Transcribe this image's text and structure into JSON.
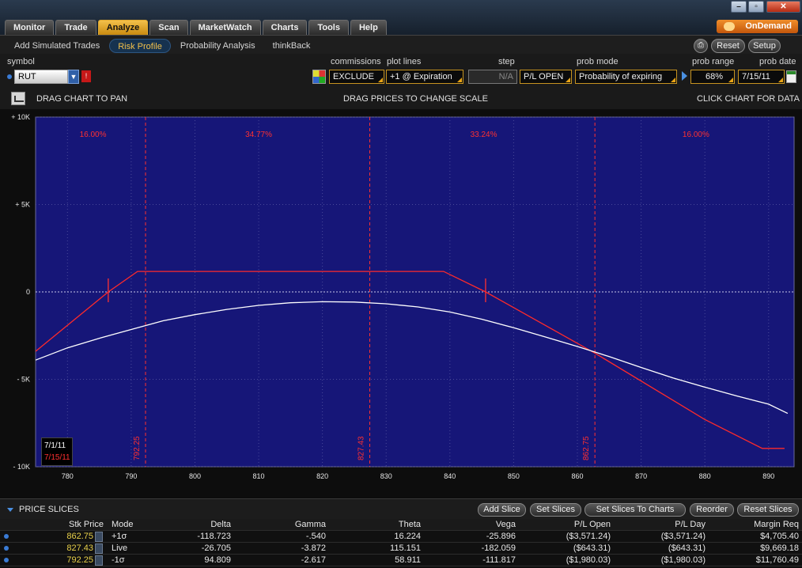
{
  "tabs": [
    "Monitor",
    "Trade",
    "Analyze",
    "Scan",
    "MarketWatch",
    "Charts",
    "Tools",
    "Help"
  ],
  "active_tab": "Analyze",
  "ondemand_label": "OnDemand",
  "window_controls": [
    "minimize-icon",
    "restore-icon",
    "close-icon"
  ],
  "subtabs": [
    "Add Simulated Trades",
    "Risk Profile",
    "Probability Analysis",
    "thinkBack"
  ],
  "active_subtab": "Risk Profile",
  "header_buttons": {
    "reset": "Reset",
    "setup": "Setup",
    "print_icon": "print-icon"
  },
  "controls": {
    "symbol_label": "symbol",
    "symbol_value": "RUT",
    "commissions_label": "commissions",
    "commissions_value": "EXCLUDE",
    "plot_lines_label": "plot lines",
    "plot_lines_value": "+1 @ Expiration",
    "step_label": "step",
    "step_value": "N/A",
    "step_mode_value": "P/L OPEN",
    "prob_mode_label": "prob mode",
    "prob_mode_value": "Probability of expiring",
    "prob_range_label": "prob range",
    "prob_range_value": "68%",
    "prob_date_label": "prob date",
    "prob_date_value": "7/15/11"
  },
  "chart_bar": {
    "left": "DRAG CHART TO PAN",
    "center": "DRAG PRICES TO CHANGE SCALE",
    "right": "CLICK CHART FOR DATA"
  },
  "chart_data": {
    "type": "line",
    "x_range": [
      775,
      894
    ],
    "y_range": [
      -10000,
      10000
    ],
    "x_ticks": [
      780,
      790,
      800,
      810,
      820,
      830,
      840,
      850,
      860,
      870,
      880,
      890
    ],
    "y_ticks": [
      {
        "value": 10000,
        "label": "+ 10K"
      },
      {
        "value": 5000,
        "label": "+ 5K"
      },
      {
        "value": 0,
        "label": "0"
      },
      {
        "value": -5000,
        "label": "- 5K"
      },
      {
        "value": -10000,
        "label": "- 10K"
      }
    ],
    "grid": true,
    "background_color": "#161678",
    "sigma_lines": [
      {
        "x": 792.25,
        "label": "792.25"
      },
      {
        "x": 827.43,
        "label": "827.43"
      },
      {
        "x": 862.75,
        "label": "862.75"
      }
    ],
    "region_probabilities": [
      {
        "x": 784,
        "label": "16.00%"
      },
      {
        "x": 810,
        "label": "34.77%"
      },
      {
        "x": 845.3,
        "label": "33.24%"
      },
      {
        "x": 878.6,
        "label": "16.00%"
      }
    ],
    "breakeven_marks": [
      786.4,
      845.6
    ],
    "series": [
      {
        "color": "#ff2a2a",
        "points": [
          [
            775,
            -3400
          ],
          [
            786.4,
            0
          ],
          [
            791,
            1170
          ],
          [
            839,
            1170
          ],
          [
            845.6,
            0
          ],
          [
            862.75,
            -3500
          ],
          [
            880,
            -7300
          ],
          [
            889,
            -8950
          ],
          [
            892.5,
            -8950
          ]
        ]
      },
      {
        "color": "#ffffff",
        "points": [
          [
            775,
            -3900
          ],
          [
            780,
            -3200
          ],
          [
            785,
            -2650
          ],
          [
            790,
            -2150
          ],
          [
            795,
            -1650
          ],
          [
            800,
            -1300
          ],
          [
            805,
            -1000
          ],
          [
            810,
            -770
          ],
          [
            815,
            -620
          ],
          [
            820,
            -560
          ],
          [
            825,
            -580
          ],
          [
            830,
            -680
          ],
          [
            835,
            -860
          ],
          [
            840,
            -1150
          ],
          [
            845,
            -1560
          ],
          [
            850,
            -2050
          ],
          [
            855,
            -2580
          ],
          [
            860,
            -3120
          ],
          [
            865,
            -3700
          ],
          [
            870,
            -4320
          ],
          [
            875,
            -4920
          ],
          [
            880,
            -5450
          ],
          [
            885,
            -5950
          ],
          [
            890,
            -6420
          ],
          [
            893,
            -6950
          ]
        ]
      }
    ],
    "date_legend": [
      {
        "label": "7/1/11",
        "color": "#ffffff"
      },
      {
        "label": "7/15/11",
        "color": "#ff3030"
      }
    ]
  },
  "price_slices": {
    "title": "PRICE SLICES",
    "buttons": [
      "Add Slice",
      "Set Slices",
      "Set Slices To Charts",
      "Reorder",
      "Reset Slices"
    ],
    "columns": [
      "Stk Price",
      "Mode",
      "Delta",
      "Gamma",
      "Theta",
      "Vega",
      "P/L Open",
      "P/L Day",
      "Margin Req"
    ],
    "rows": [
      [
        "862.75",
        "+1σ",
        "-118.723",
        "-.540",
        "16.224",
        "-25.896",
        "($3,571.24)",
        "($3,571.24)",
        "$4,705.40"
      ],
      [
        "827.43",
        "Live",
        "-26.705",
        "-3.872",
        "115.151",
        "-182.059",
        "($643.31)",
        "($643.31)",
        "$9,669.18"
      ],
      [
        "792.25",
        "-1σ",
        "94.809",
        "-2.617",
        "58.911",
        "-111.817",
        "($1,980.03)",
        "($1,980.03)",
        "$11,760.49"
      ]
    ]
  }
}
